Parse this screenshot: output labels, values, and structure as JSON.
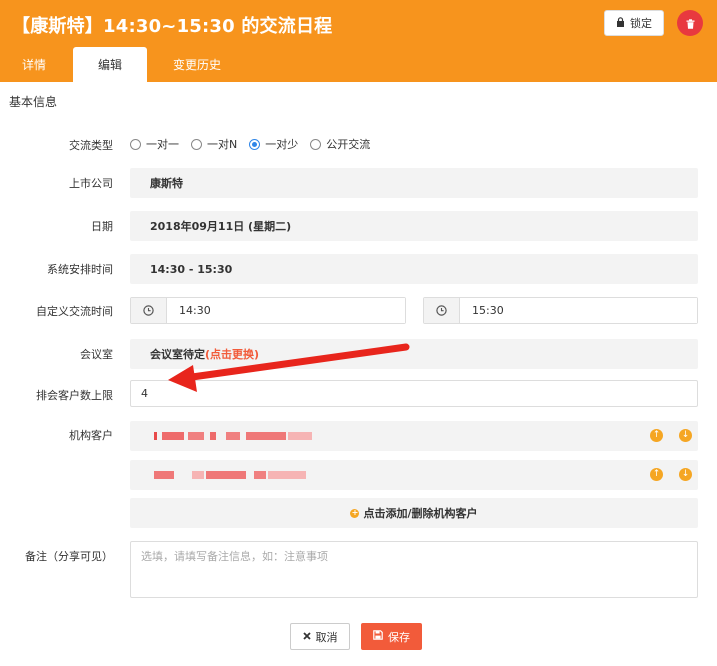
{
  "header": {
    "title": "【康斯特】14:30~15:30 的交流日程",
    "lock_label": "锁定",
    "colors": {
      "bar": "#f7941d",
      "delete": "#e8393f"
    }
  },
  "tabs": [
    {
      "label": "详情",
      "active": false
    },
    {
      "label": "编辑",
      "active": true
    },
    {
      "label": "变更历史",
      "active": false
    }
  ],
  "section": {
    "title": "基本信息"
  },
  "form": {
    "exchange_type": {
      "label": "交流类型",
      "options": [
        "一对一",
        "一对N",
        "一对少",
        "公开交流"
      ],
      "selected": "一对少"
    },
    "company": {
      "label": "上市公司",
      "value": "康斯特"
    },
    "date": {
      "label": "日期",
      "value": "2018年09月11日 (星期二)"
    },
    "system_time": {
      "label": "系统安排时间",
      "value": "14:30 - 15:30"
    },
    "custom_time": {
      "label": "自定义交流时间",
      "start": "14:30",
      "end": "15:30"
    },
    "meeting_room": {
      "label": "会议室",
      "value": "会议室待定",
      "change_link": "(点击更换)"
    },
    "client_limit": {
      "label": "排会客户数上限",
      "value": "4"
    },
    "clients": {
      "label": "机构客户",
      "add_label": "点击添加/删除机构客户"
    },
    "notes": {
      "label": "备注（分享可见）",
      "placeholder": "选填，请填写备注信息，如：注意事项"
    }
  },
  "actions": {
    "cancel": "取消",
    "save": "保存",
    "save_color": "#f25b3a"
  },
  "icons": {
    "lock": "lock-icon",
    "delete": "trash-icon",
    "clock": "clock-icon",
    "up": "arrow-up-circle-icon",
    "down": "arrow-down-circle-icon",
    "add": "plus-circle-icon",
    "cancel": "close-icon",
    "save": "floppy-icon"
  }
}
